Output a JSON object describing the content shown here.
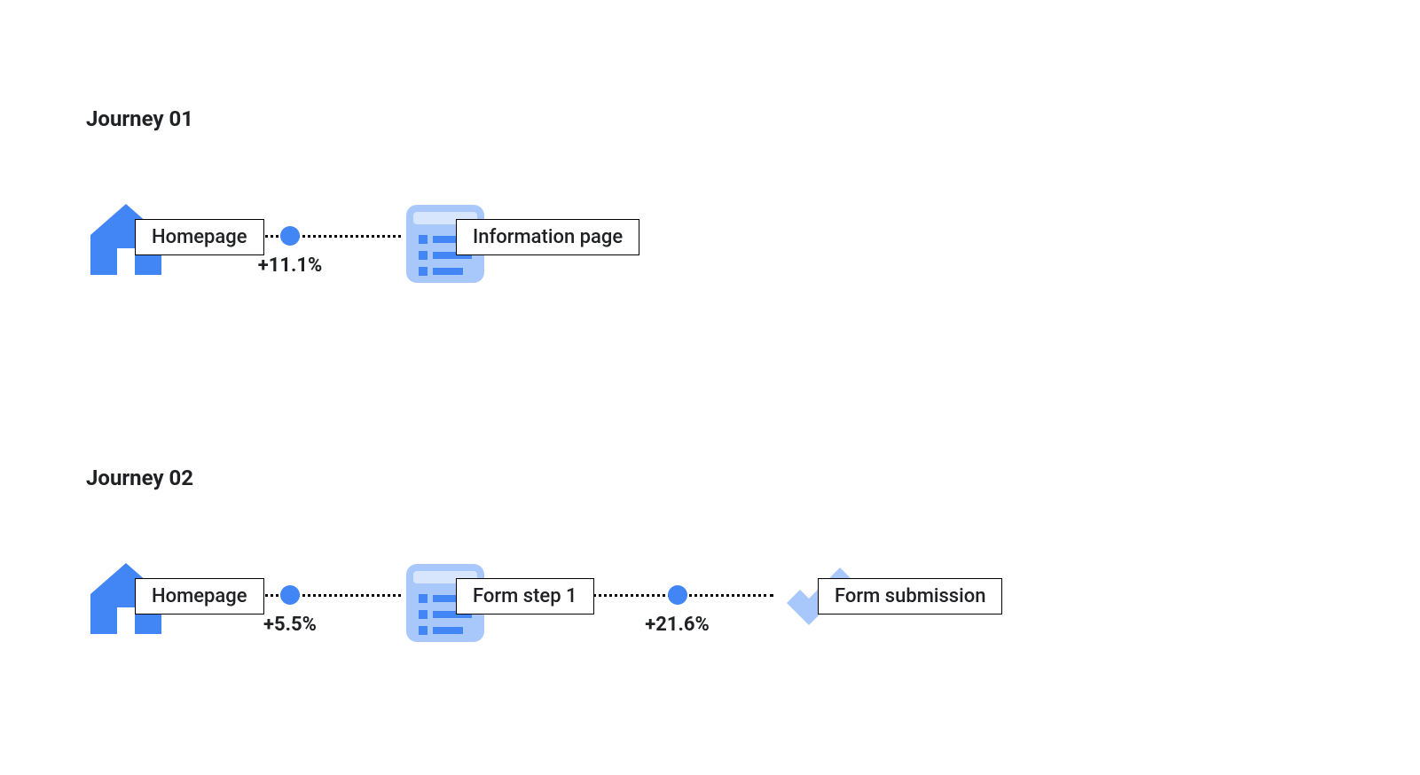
{
  "colors": {
    "icon_primary": "#4285F4",
    "icon_light": "#A8C7FA",
    "text": "#202124",
    "border": "#000000",
    "background": "#ffffff"
  },
  "journeys": [
    {
      "title": "Journey 01",
      "steps": [
        {
          "icon": "home",
          "label": "Homepage"
        },
        {
          "icon": "list",
          "label": "Information page"
        }
      ],
      "connectors": [
        {
          "value": "+11.1%"
        }
      ]
    },
    {
      "title": "Journey 02",
      "steps": [
        {
          "icon": "home",
          "label": "Homepage"
        },
        {
          "icon": "list",
          "label": "Form step 1"
        },
        {
          "icon": "check",
          "label": "Form submission"
        }
      ],
      "connectors": [
        {
          "value": "+5.5%"
        },
        {
          "value": "+21.6%"
        }
      ]
    }
  ]
}
